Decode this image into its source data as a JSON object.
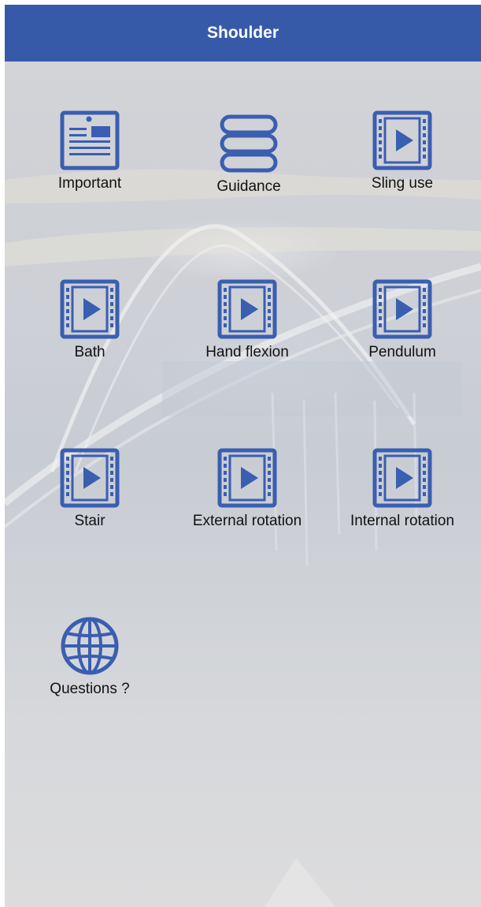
{
  "header": {
    "title": "Shoulder"
  },
  "theme": {
    "header_color": "#375aa8",
    "icon_color": "#3a5eb0"
  },
  "tiles": [
    {
      "label": "Important",
      "icon": "document-icon"
    },
    {
      "label": "Guidance",
      "icon": "stack-icon"
    },
    {
      "label": "Sling use",
      "icon": "video-icon"
    },
    {
      "label": "Bath",
      "icon": "video-icon"
    },
    {
      "label": "Hand flexion",
      "icon": "video-icon"
    },
    {
      "label": "Pendulum",
      "icon": "video-icon"
    },
    {
      "label": "Stair",
      "icon": "video-icon"
    },
    {
      "label": "External rotation",
      "icon": "video-icon"
    },
    {
      "label": "Internal rotation",
      "icon": "video-icon"
    },
    {
      "label": "Questions ?",
      "icon": "globe-icon"
    }
  ]
}
